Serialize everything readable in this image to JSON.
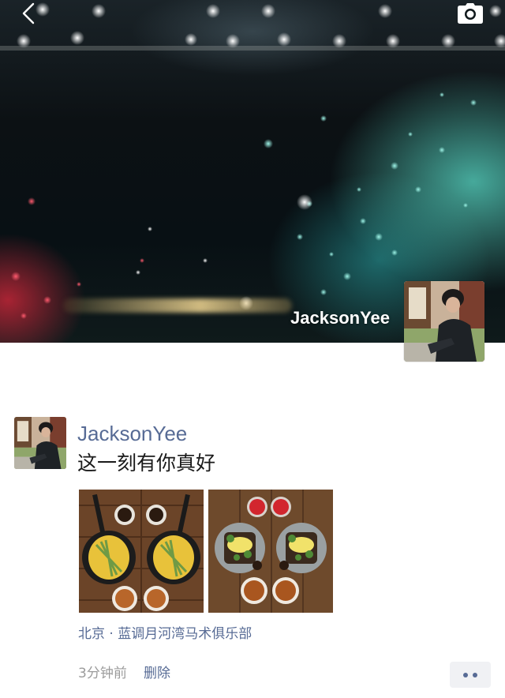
{
  "header": {
    "back_icon": "chevron-left-icon",
    "camera_icon": "camera-icon"
  },
  "profile": {
    "name": "JacksonYee"
  },
  "post": {
    "author": "JacksonYee",
    "text": "这一刻有你真好",
    "photos": [
      "food-photo-omelette-pans",
      "food-photo-avocado-toast"
    ],
    "location": "北京 · 蓝调月河湾马术俱乐部",
    "timestamp": "3分钟前",
    "delete_label": "删除",
    "more_icon": "more-dots-icon"
  },
  "colors": {
    "link_blue": "#576b95",
    "meta_gray": "#9b9b9b",
    "more_button_bg": "#f0f1f4"
  }
}
